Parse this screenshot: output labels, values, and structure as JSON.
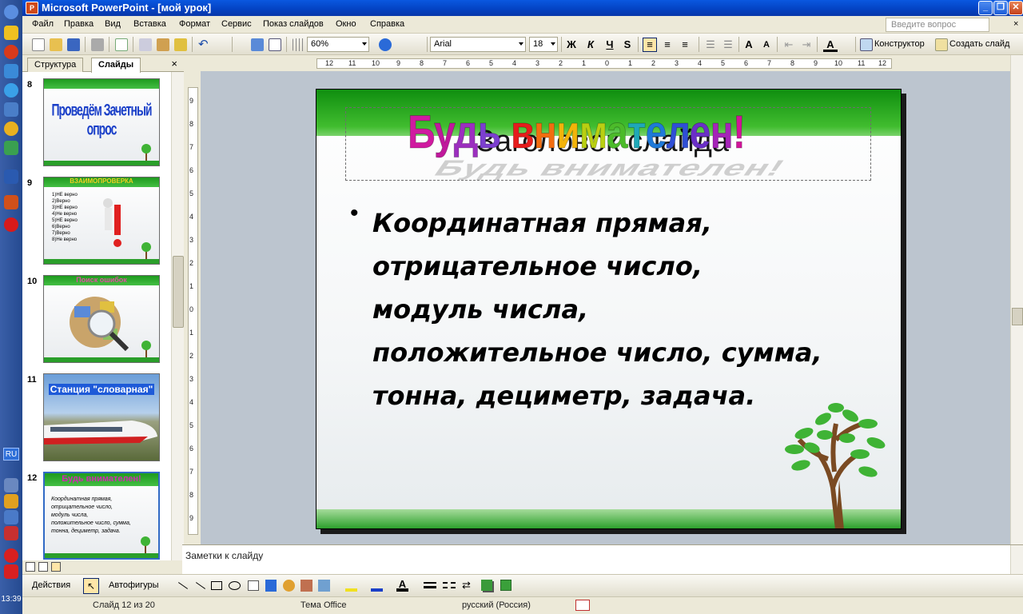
{
  "window": {
    "title": "Microsoft PowerPoint - [мой урок]",
    "app_icon_letter": "P"
  },
  "menu": {
    "items": [
      "Файл",
      "Правка",
      "Вид",
      "Вставка",
      "Формат",
      "Сервис",
      "Показ слайдов",
      "Окно",
      "Справка"
    ],
    "help_placeholder": "Введите вопрос",
    "close": "×"
  },
  "toolbar": {
    "zoom": "60%",
    "font": "Arial",
    "font_size": "18",
    "bold": "Ж",
    "italic": "К",
    "underline": "Ч",
    "shadow": "S",
    "designer": "Конструктор",
    "new_slide": "Создать слайд"
  },
  "left_panel": {
    "tabs": [
      "Структура",
      "Слайды"
    ],
    "close": "×",
    "thumbnails": [
      {
        "number": "8",
        "title": "Проведём Зачетный опрос"
      },
      {
        "number": "9",
        "title": "ВЗАИМОПРОВЕРКА",
        "lines": [
          "1)НЕ верно",
          "2)Верно",
          "3)НЕ верно",
          "4)Не верно",
          "5)НЕ верно",
          "6)Верно",
          "7)Верно",
          "8)Не верно"
        ]
      },
      {
        "number": "10",
        "title": "Поиск ошибок"
      },
      {
        "number": "11",
        "title": "Станция \"словарная\""
      },
      {
        "number": "12",
        "title": "Будь внимателен!",
        "lines": [
          "Координатная прямая,",
          "отрицательное число,",
          "модуль числа,",
          "положительное число, сумма,",
          "тонна, дециметр, задача."
        ]
      }
    ]
  },
  "rulers": {
    "horizontal": [
      "12",
      "11",
      "10",
      "9",
      "8",
      "7",
      "6",
      "5",
      "4",
      "3",
      "2",
      "1",
      "0",
      "1",
      "2",
      "3",
      "4",
      "5",
      "6",
      "7",
      "8",
      "9",
      "10",
      "11",
      "12"
    ],
    "vertical": [
      "9",
      "8",
      "7",
      "6",
      "5",
      "4",
      "3",
      "2",
      "1",
      "0",
      "1",
      "2",
      "3",
      "4",
      "5",
      "6",
      "7",
      "8",
      "9"
    ]
  },
  "slide": {
    "placeholder_title": "Заголовок слайда",
    "wordart": [
      {
        "ch": "Б",
        "color": "#d01aa0"
      },
      {
        "ch": "у",
        "color": "#c0189c"
      },
      {
        "ch": "д",
        "color": "#9c2fbf"
      },
      {
        "ch": "ь",
        "color": "#7c3fcf"
      },
      {
        "ch": " ",
        "color": "#000000"
      },
      {
        "ch": "в",
        "color": "#e61c1c"
      },
      {
        "ch": "н",
        "color": "#f26d0f"
      },
      {
        "ch": "и",
        "color": "#f3b40a"
      },
      {
        "ch": "м",
        "color": "#b9cf12"
      },
      {
        "ch": "а",
        "color": "#4cbb2a"
      },
      {
        "ch": "т",
        "color": "#1fa8b8"
      },
      {
        "ch": "е",
        "color": "#1e79d8"
      },
      {
        "ch": "л",
        "color": "#2f4fd6"
      },
      {
        "ch": "е",
        "color": "#6a2fc7"
      },
      {
        "ch": "н",
        "color": "#a524b8"
      },
      {
        "ch": "!",
        "color": "#d2149a"
      }
    ],
    "wordart_shadow": "Будь внимателен!",
    "bullet_char": "•",
    "body_lines": [
      "Координатная прямая,",
      "отрицательное число,",
      "модуль числа,",
      "положительное число, сумма,",
      "тонна, дециметр, задача."
    ],
    "colors": {
      "band_green": "#2fa82a",
      "leaf": "#3fb335",
      "trunk": "#7a4a22"
    }
  },
  "notes": {
    "placeholder": "Заметки к слайду"
  },
  "drawbar": {
    "actions": "Действия",
    "autoshapes": "Автофигуры"
  },
  "status": {
    "slide_counter": "Слайд 12 из 20",
    "theme": "Тема Office",
    "language": "русский (Россия)"
  },
  "os": {
    "lang": "RU",
    "clock": "13:39"
  }
}
